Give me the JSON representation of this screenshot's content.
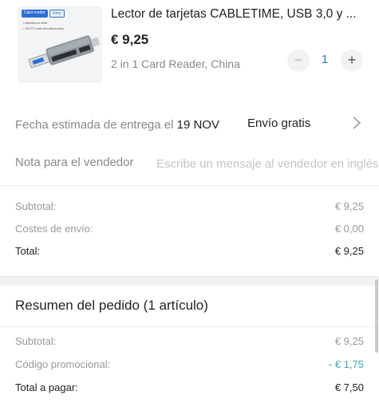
{
  "product": {
    "image_tags": [
      "Card reader",
      "Grey"
    ],
    "image_lines": [
      "• Aluminium shell",
      "• SD/TF read simultaneously"
    ],
    "title": "Lector de tarjetas CABLETIME, USB 3,0 y ...",
    "price": "€ 9,25",
    "variant": "2 in 1 Card Reader, China",
    "quantity": "1",
    "minus_label": "−",
    "plus_label": "+"
  },
  "delivery": {
    "label": "Fecha estimada de entrega el ",
    "date": "19 NOV",
    "shipping": "Envío gratis"
  },
  "note": {
    "label": "Nota para el vendedor",
    "placeholder": "Escribe un mensaje al vendedor en inglés"
  },
  "costs": {
    "subtotal_label": "Subtotal:",
    "subtotal_value": "€ 9,25",
    "shipping_label": "Costes de envío:",
    "shipping_value": "€ 0,00",
    "total_label": "Total:",
    "total_value": "€ 9,25"
  },
  "summary": {
    "title": "Resumen del pedido (1 artículo)",
    "subtotal_label": "Subtotal:",
    "subtotal_value": "€ 9,25",
    "promo_label": "Código promocional:",
    "promo_value": "- € 1,75",
    "pay_label": "Total a pagar:",
    "pay_value": "€ 7,50"
  },
  "colors": {
    "accent": "#2b6fd6",
    "promo": "#3aa8b8"
  }
}
